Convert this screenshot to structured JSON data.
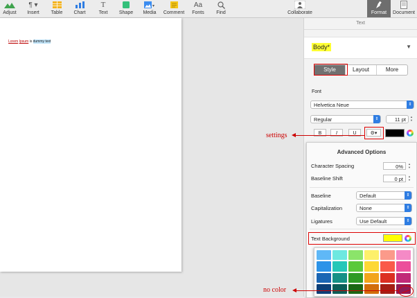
{
  "toolbar": {
    "items": [
      {
        "label": "Adjust",
        "icon": "adjust-icon"
      },
      {
        "label": "Insert",
        "icon": "insert-paragraph-icon"
      },
      {
        "label": "Table",
        "icon": "table-icon"
      },
      {
        "label": "Chart",
        "icon": "chart-icon"
      },
      {
        "label": "Text",
        "icon": "text-icon"
      },
      {
        "label": "Shape",
        "icon": "shape-icon"
      },
      {
        "label": "Media",
        "icon": "media-icon"
      },
      {
        "label": "Comment",
        "icon": "comment-icon"
      },
      {
        "label": "Fonts",
        "icon": "fonts-icon"
      },
      {
        "label": "Find",
        "icon": "find-icon"
      },
      {
        "label": "Collaborate",
        "icon": "collaborate-icon"
      },
      {
        "label": "Format",
        "icon": "format-brush-icon"
      },
      {
        "label": "Document",
        "icon": "document-icon"
      }
    ]
  },
  "document": {
    "text_part1": "Lorem",
    "text_part2": "Ipsum",
    "text_part3": "is",
    "text_part4": "dummy text"
  },
  "panel": {
    "header": "Text",
    "style_name": "Body*",
    "tabs": [
      "Style",
      "Layout",
      "More"
    ],
    "font_section": "Font",
    "font_family": "Helvetica Neue",
    "font_weight": "Regular",
    "font_size": "11 pt",
    "bold": "B",
    "italic": "I",
    "underline": "U",
    "text_color": "#000000"
  },
  "advanced": {
    "title": "Advanced Options",
    "character_spacing_label": "Character Spacing",
    "character_spacing_value": "0%",
    "baseline_shift_label": "Baseline Shift",
    "baseline_shift_value": "0 pt",
    "baseline_label": "Baseline",
    "baseline_value": "Default",
    "capitalization_label": "Capitalization",
    "capitalization_value": "None",
    "ligatures_label": "Ligatures",
    "ligatures_value": "Use Default",
    "text_background_label": "Text Background",
    "text_background_color": "#ffff00"
  },
  "swatches": [
    "#5fb8f7",
    "#6de8e0",
    "#8be46a",
    "#fdf06a",
    "#fb9a8a",
    "#f58ac6",
    "#2c93e8",
    "#25c7b8",
    "#5bc93b",
    "#fdd835",
    "#fa5a4a",
    "#ec4f9b",
    "#1b66b4",
    "#169186",
    "#2f9a25",
    "#f2a51b",
    "#dc2f22",
    "#c12a78",
    "#0c3f78",
    "#0c5e58",
    "#1b6614",
    "#d26e0b",
    "#a51e15",
    "#8e1a55"
  ],
  "annotations": {
    "settings": "settings",
    "no_color": "no color"
  }
}
